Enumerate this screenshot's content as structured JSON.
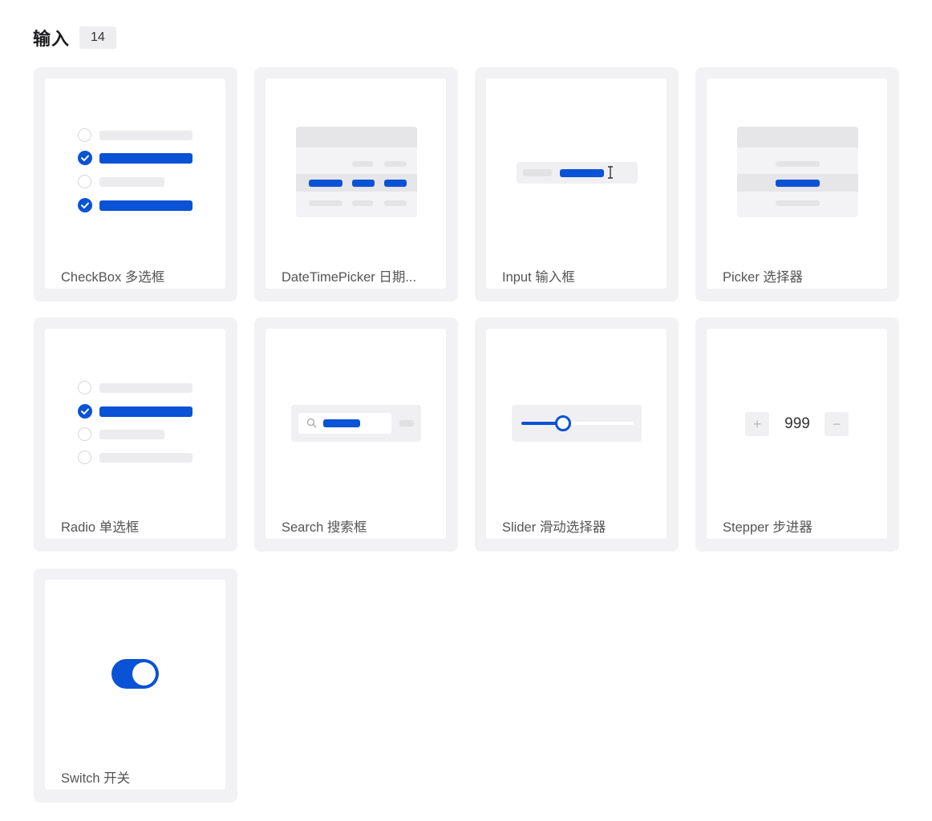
{
  "section": {
    "title": "输入",
    "count": "14"
  },
  "cards": [
    {
      "label": "CheckBox 多选框"
    },
    {
      "label": "DateTimePicker 日期..."
    },
    {
      "label": "Input 输入框"
    },
    {
      "label": "Picker 选择器"
    },
    {
      "label": "Radio 单选框"
    },
    {
      "label": "Search 搜索框"
    },
    {
      "label": "Slider 滑动选择器"
    },
    {
      "label": "Stepper 步进器"
    },
    {
      "label": "Switch 开关"
    }
  ],
  "stepper": {
    "plus": "+",
    "value": "999",
    "minus": "−"
  },
  "colors": {
    "accent": "#0a52d6",
    "card_bg": "#f2f2f4",
    "placeholder": "#ececee"
  },
  "icons": [
    "check-icon",
    "radio-off-icon",
    "search-icon",
    "text-cursor-icon",
    "slider-thumb-icon",
    "switch-knob-icon"
  ]
}
